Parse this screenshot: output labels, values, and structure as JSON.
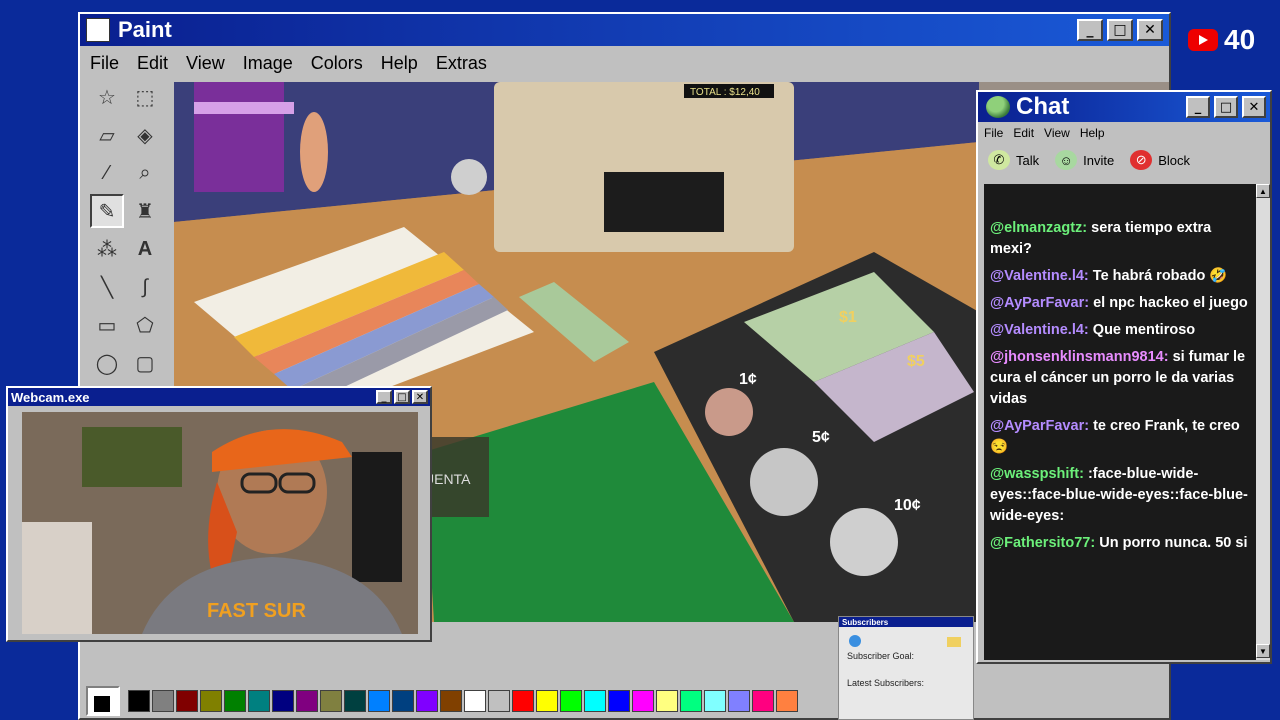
{
  "paint": {
    "title": "Paint",
    "menu": [
      "File",
      "Edit",
      "View",
      "Image",
      "Colors",
      "Help",
      "Extras"
    ],
    "palette": [
      "#000000",
      "#808080",
      "#800000",
      "#808000",
      "#008000",
      "#008080",
      "#000080",
      "#800080",
      "#808040",
      "#004040",
      "#0080ff",
      "#004080",
      "#8000ff",
      "#804000",
      "#ffffff",
      "#c0c0c0",
      "#ff0000",
      "#ffff00",
      "#00ff00",
      "#00ffff",
      "#0000ff",
      "#ff00ff",
      "#ffff80",
      "#00ff80",
      "#80ffff",
      "#8080ff",
      "#ff0080",
      "#ff8040"
    ]
  },
  "game": {
    "total": "TOTAL : $12,40",
    "compartments": {
      "c1": "1¢",
      "c5": "5¢",
      "c10": "10¢",
      "d1": "$1",
      "d5": "$5"
    },
    "counter_label": "UENTA"
  },
  "chat": {
    "title": "Chat",
    "menu": [
      "File",
      "Edit",
      "View",
      "Help"
    ],
    "actions": {
      "talk": "Talk",
      "invite": "Invite",
      "block": "Block"
    },
    "messages": [
      {
        "user": "@elmanzagtz:",
        "text": "sera tiempo extra mexi?",
        "color": "#6cf07a"
      },
      {
        "user": "@Valentine.l4:",
        "text": "Te habrá robado 🤣",
        "color": "#b48cff"
      },
      {
        "user": "@AyParFavar:",
        "text": "el npc hackeo el juego",
        "color": "#b48cff"
      },
      {
        "user": "@Valentine.l4:",
        "text": "Que mentiroso",
        "color": "#b48cff"
      },
      {
        "user": "@jhonsenklinsmann9814:",
        "text": "si fumar le cura el cáncer un porro le da varias vidas",
        "color": "#e88cff"
      },
      {
        "user": "@AyParFavar:",
        "text": "te creo Frank, te creo 😒",
        "color": "#b48cff"
      },
      {
        "user": "@wasspshift:",
        "text": ":face-blue-wide-eyes::face-blue-wide-eyes::face-blue-wide-eyes:",
        "color": "#6cf07a"
      },
      {
        "user": "@Fathersito77:",
        "text": "Un porro nunca. 50 si",
        "color": "#6cf07a"
      }
    ]
  },
  "webcam": {
    "title": "Webcam.exe",
    "shirt_text": "FAST SUR"
  },
  "subscribers": {
    "title": "Subscribers",
    "goal_label": "Subscriber Goal:",
    "latest_label": "Latest Subscribers:"
  },
  "youtube": {
    "count": "40"
  }
}
